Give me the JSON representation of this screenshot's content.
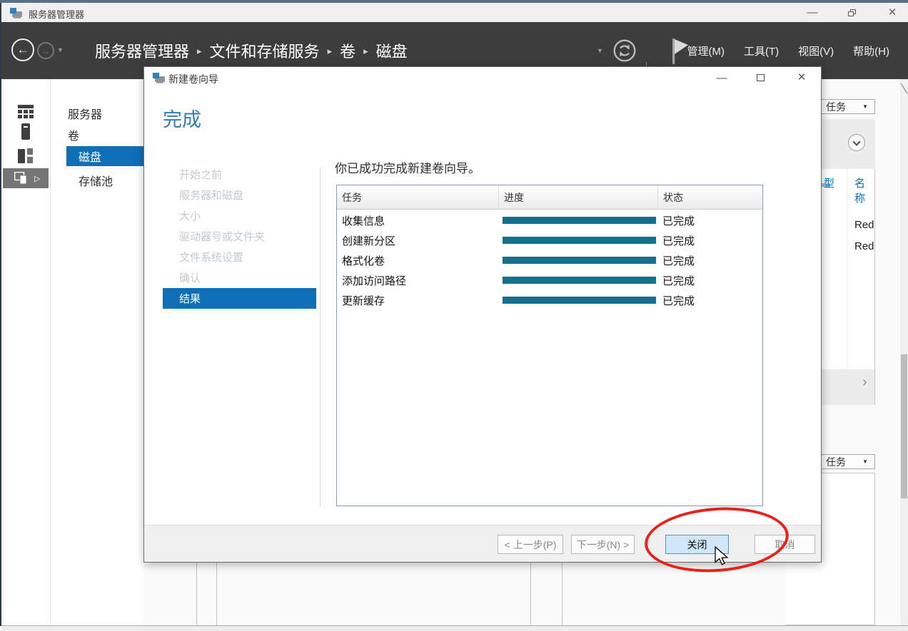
{
  "colors": {
    "accent_blue": "#0e6eb6",
    "heading_blue": "#2d7db6",
    "progress_teal": "#15708e",
    "annotation_red": "#e8211a",
    "toolbar_dark": "#3d3d3d",
    "strip_blue": "#5b6e87"
  },
  "glyphs": {
    "caret_down": "▼",
    "crumb_separator": "▸",
    "back_arrow": "←",
    "forward_arrow": "→",
    "expand_right": "▷",
    "chevron_right": "›",
    "minimize": "—",
    "close": "×"
  },
  "window": {
    "title": "服务器管理器"
  },
  "toolbar": {
    "breadcrumb": [
      "服务器管理器",
      "文件和存储服务",
      "卷",
      "磁盘"
    ],
    "menus": [
      {
        "label": "管理(M)"
      },
      {
        "label": "工具(T)"
      },
      {
        "label": "视图(V)"
      },
      {
        "label": "帮助(H)"
      }
    ]
  },
  "sidebar": {
    "items": [
      {
        "label": "服务器"
      },
      {
        "label": "卷"
      },
      {
        "label": "磁盘"
      },
      {
        "label": "存储池"
      }
    ]
  },
  "right_panel": {
    "tasks_top": "任务",
    "tasks_bottom": "任务",
    "columns": [
      "型",
      "名称"
    ],
    "rows": [
      "Red",
      "Red"
    ]
  },
  "dialog": {
    "title": "新建卷向导",
    "heading": "完成",
    "statement": "你已成功完成新建卷向导。",
    "steps": [
      {
        "label": "开始之前"
      },
      {
        "label": "服务器和磁盘"
      },
      {
        "label": "大小"
      },
      {
        "label": "驱动器号或文件夹"
      },
      {
        "label": "文件系统设置"
      },
      {
        "label": "确认"
      },
      {
        "label": "结果"
      }
    ],
    "table": {
      "columns": [
        "任务",
        "进度",
        "状态"
      ],
      "rows": [
        {
          "task": "收集信息",
          "progress": 100,
          "status": "已完成"
        },
        {
          "task": "创建新分区",
          "progress": 100,
          "status": "已完成"
        },
        {
          "task": "格式化卷",
          "progress": 100,
          "status": "已完成"
        },
        {
          "task": "添加访问路径",
          "progress": 100,
          "status": "已完成"
        },
        {
          "task": "更新缓存",
          "progress": 100,
          "status": "已完成"
        }
      ]
    },
    "buttons": {
      "back": "< 上一步(P)",
      "next": "下一步(N) >",
      "close": "关闭",
      "cancel": "取消"
    }
  }
}
